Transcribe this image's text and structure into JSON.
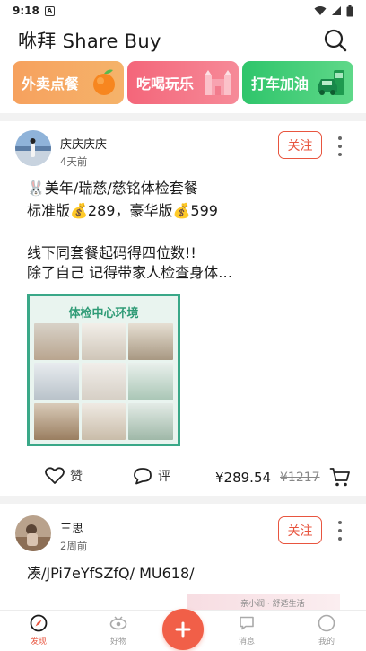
{
  "status_bar": {
    "time": "9:18",
    "notif_letter": "A"
  },
  "header": {
    "title": "咻拜 Share Buy"
  },
  "categories": [
    {
      "label": "外卖点餐",
      "color": "#f6a15e"
    },
    {
      "label": "吃喝玩乐",
      "color": "#f4667a"
    },
    {
      "label": "打车加油",
      "color": "#2fc56b"
    }
  ],
  "posts": [
    {
      "user": "庆庆庆庆",
      "time": "4天前",
      "follow_label": "关注",
      "lines": [
        "🐰美年/瑞慈/慈铭体检套餐",
        "标准版💰289，豪华版💰599",
        "",
        "线下同套餐起码得四位数!!",
        "除了自己 记得带家人检查身体…"
      ],
      "image_title": "体检中心环境",
      "like_label": "赞",
      "comment_label": "评",
      "price": "¥289.54",
      "old_price": "¥1217"
    },
    {
      "user": "三思",
      "time": "2周前",
      "follow_label": "关注",
      "lines": [
        "凑/JPi7eYfSZfQ/ MU618/"
      ],
      "image_caption": "亲小润 · 舒适生活"
    }
  ],
  "bottom_nav": [
    {
      "label": "发现",
      "active": true
    },
    {
      "label": "好物",
      "active": false
    },
    {
      "label": "消息",
      "active": false
    },
    {
      "label": "我的",
      "active": false
    }
  ],
  "colors": {
    "accent": "#e8553f",
    "fab": "#f15f48"
  }
}
